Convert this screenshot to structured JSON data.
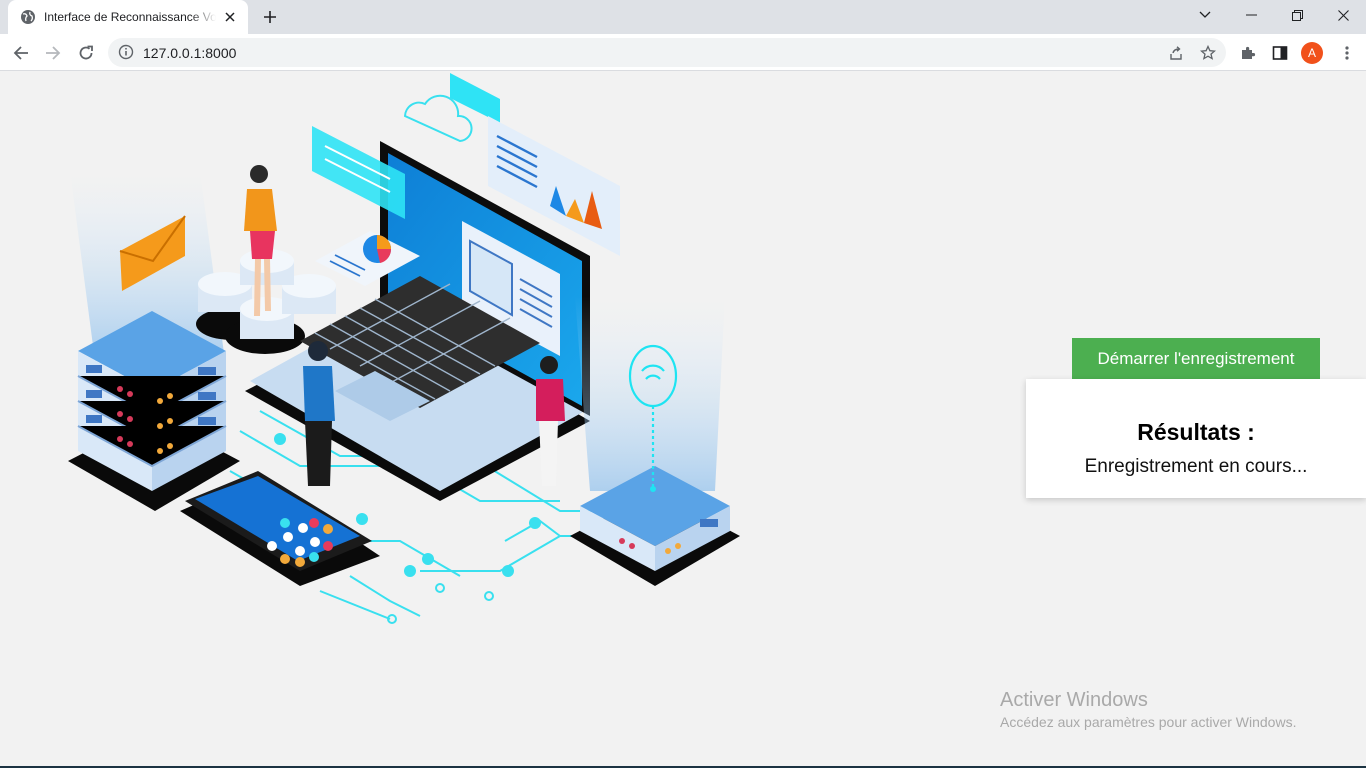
{
  "browser": {
    "tab_title": "Interface de Reconnaissance Vocale",
    "url": "127.0.0.1:8000",
    "profile_initial": "A"
  },
  "main": {
    "start_button_label": "Démarrer l'enregistrement",
    "results_title": "Résultats :",
    "results_status": "Enregistrement en cours..."
  },
  "windows_activation": {
    "title": "Activer Windows",
    "subtitle": "Accédez aux paramètres pour activer Windows."
  },
  "colors": {
    "start_button": "#4caf50",
    "avatar": "#f1511b",
    "page_background": "#f2f2f2"
  },
  "icons": [
    "globe-icon",
    "close-icon",
    "plus-icon",
    "chevron-down-icon",
    "minimize-icon",
    "restore-icon",
    "window-close-icon",
    "back-arrow-icon",
    "forward-arrow-icon",
    "reload-icon",
    "info-icon",
    "share-icon",
    "star-icon",
    "puzzle-icon",
    "side-panel-icon"
  ]
}
